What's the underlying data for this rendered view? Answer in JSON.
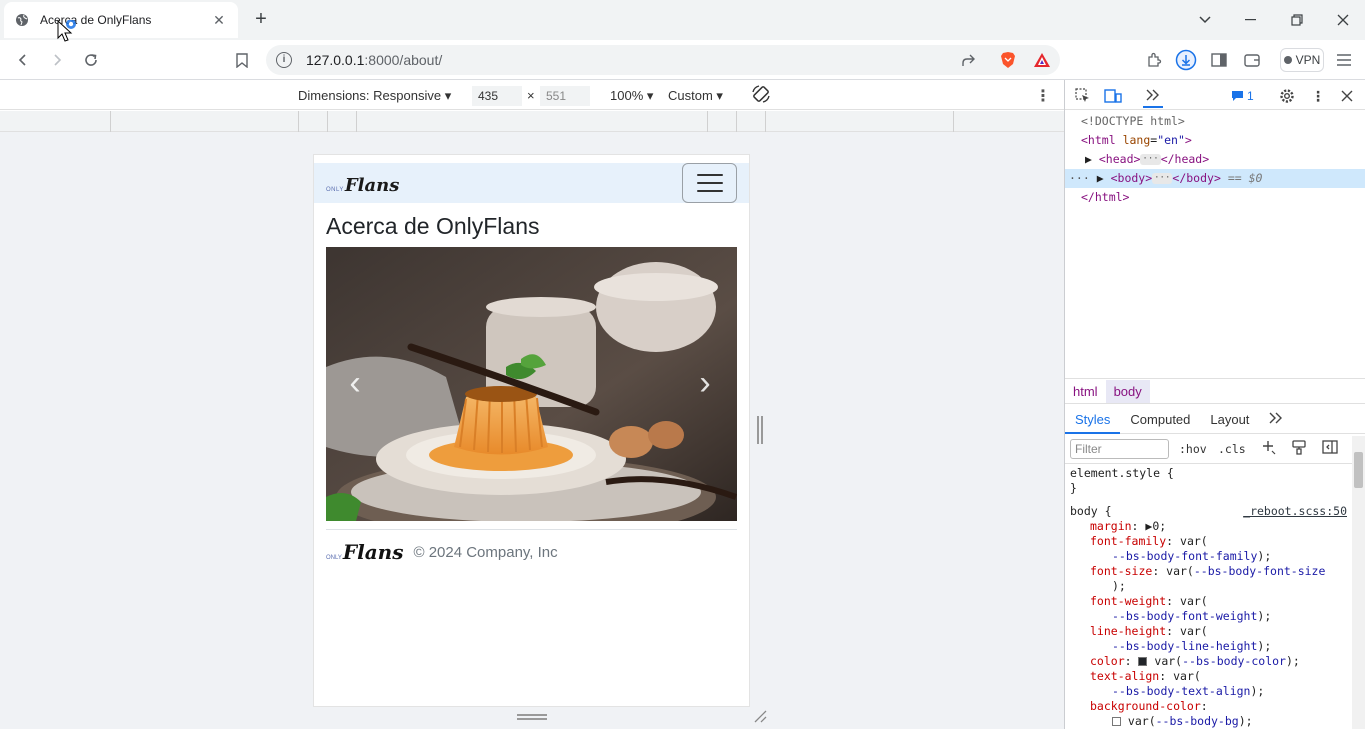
{
  "browser": {
    "tab_title": "Acerca de OnlyFlans",
    "url_host": "127.0.0.1",
    "url_rest": ":8000/about/",
    "vpn_label": "VPN"
  },
  "device_toolbar": {
    "dimensions_label": "Dimensions: Responsive",
    "width_value": "435",
    "times": "×",
    "height_placeholder": "551",
    "zoom": "100%",
    "throttle": "Custom"
  },
  "page": {
    "brand_only": "ONLY",
    "brand_flans": "Flans",
    "title": "Acerca de OnlyFlans",
    "footer_copy": "© 2024 Company, Inc",
    "carousel_prev": "‹",
    "carousel_next": "›"
  },
  "devtools": {
    "badge_count": "1",
    "dom": {
      "doctype": "<!DOCTYPE html>",
      "html_open": "<html",
      "lang_attr": "lang",
      "lang_val": "\"en\"",
      "head_tag": "<head>",
      "head_close": "</head>",
      "body_tag": "<body>",
      "body_close": "</body>",
      "sel_marker": "== $0",
      "html_close": "</html>"
    },
    "breadcrumbs": [
      "html",
      "body"
    ],
    "subtabs": [
      "Styles",
      "Computed",
      "Layout"
    ],
    "filter_placeholder": "Filter",
    "hov": ":hov",
    "cls": ".cls",
    "styles": {
      "element_style": "element.style {",
      "close_brace": "}",
      "body_selector": "body {",
      "source": "_reboot.scss:50",
      "margin_prop": "margin",
      "margin_val": "0;",
      "ff_prop": "font-family",
      "ff_var": "--bs-body-font-family",
      "fs_prop": "font-size",
      "fs_var": "--bs-body-font-size",
      "fw_prop": "font-weight",
      "fw_var": "--bs-body-font-weight",
      "lh_prop": "line-height",
      "lh_var": "--bs-body-line-height",
      "color_prop": "color",
      "color_var": "--bs-body-color",
      "ta_prop": "text-align",
      "ta_var": "--bs-body-text-align",
      "bg_prop": "background-color",
      "bg_var": "--bs-body-bg"
    }
  }
}
